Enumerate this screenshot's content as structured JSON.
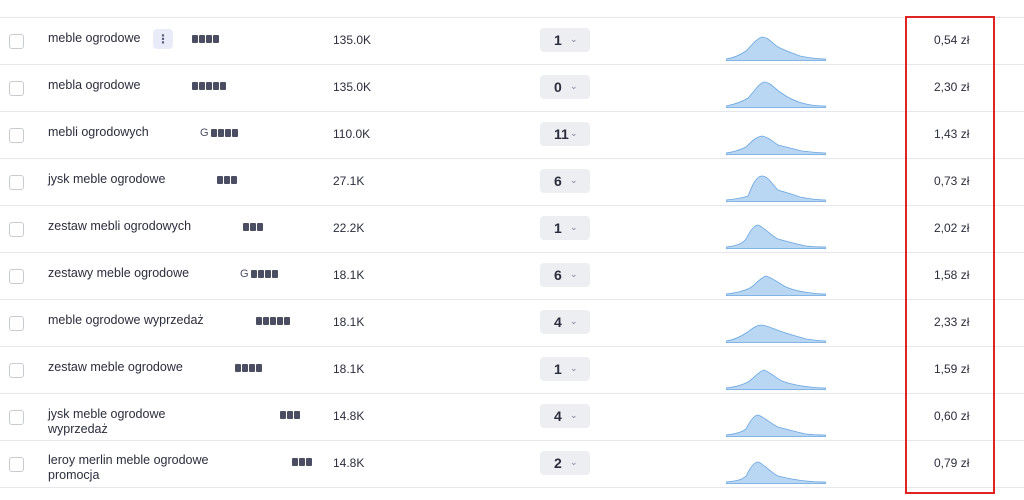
{
  "rows": [
    {
      "keyword": "meble ogrodowe",
      "serp_icons": [
        "image",
        "map",
        "shopping",
        "video"
      ],
      "volume": "135.0K",
      "kd": "1",
      "cpc": "0,54 zł",
      "menu": "⋮"
    },
    {
      "keyword": "mebla ogrodowe",
      "serp_icons": [
        "image",
        "map",
        "shopping",
        "video",
        "book"
      ],
      "volume": "135.0K",
      "kd": "0",
      "cpc": "2,30 zł"
    },
    {
      "keyword": "mebli ogrodowych",
      "serp_icons": [
        "google",
        "image",
        "map",
        "shopping",
        "video"
      ],
      "volume": "110.0K",
      "kd": "11",
      "cpc": "1,43 zł"
    },
    {
      "keyword": "jysk meble ogrodowe",
      "serp_icons": [
        "image",
        "shopping",
        "video"
      ],
      "volume": "27.1K",
      "kd": "6",
      "cpc": "0,73 zł"
    },
    {
      "keyword": "zestaw mebli ogrodowych",
      "serp_icons": [
        "image",
        "shopping",
        "video"
      ],
      "volume": "22.2K",
      "kd": "1",
      "cpc": "2,02 zł"
    },
    {
      "keyword": "zestawy meble ogrodowe",
      "serp_icons": [
        "google",
        "image",
        "map",
        "shopping",
        "video"
      ],
      "volume": "18.1K",
      "kd": "6",
      "cpc": "1,58 zł"
    },
    {
      "keyword": "meble ogrodowe wyprzedaż",
      "serp_icons": [
        "image",
        "map",
        "shopping",
        "video",
        "book"
      ],
      "volume": "18.1K",
      "kd": "4",
      "cpc": "2,33 zł"
    },
    {
      "keyword": "zestaw meble ogrodowe",
      "serp_icons": [
        "image",
        "map",
        "shopping",
        "video"
      ],
      "volume": "18.1K",
      "kd": "1",
      "cpc": "1,59 zł"
    },
    {
      "keyword": "jysk meble ogrodowe wyprzedaż",
      "serp_icons": [
        "image",
        "shopping",
        "video"
      ],
      "volume": "14.8K",
      "kd": "4",
      "cpc": "0,60 zł"
    },
    {
      "keyword": "leroy merlin meble ogrodowe promocja",
      "serp_icons": [
        "image",
        "shopping",
        "video"
      ],
      "volume": "14.8K",
      "kd": "2",
      "cpc": "0,79 zł"
    }
  ],
  "colors": {
    "trend_fill": "#b9d6f3",
    "trend_stroke": "#6aa6e0",
    "highlight": "#e02424"
  }
}
